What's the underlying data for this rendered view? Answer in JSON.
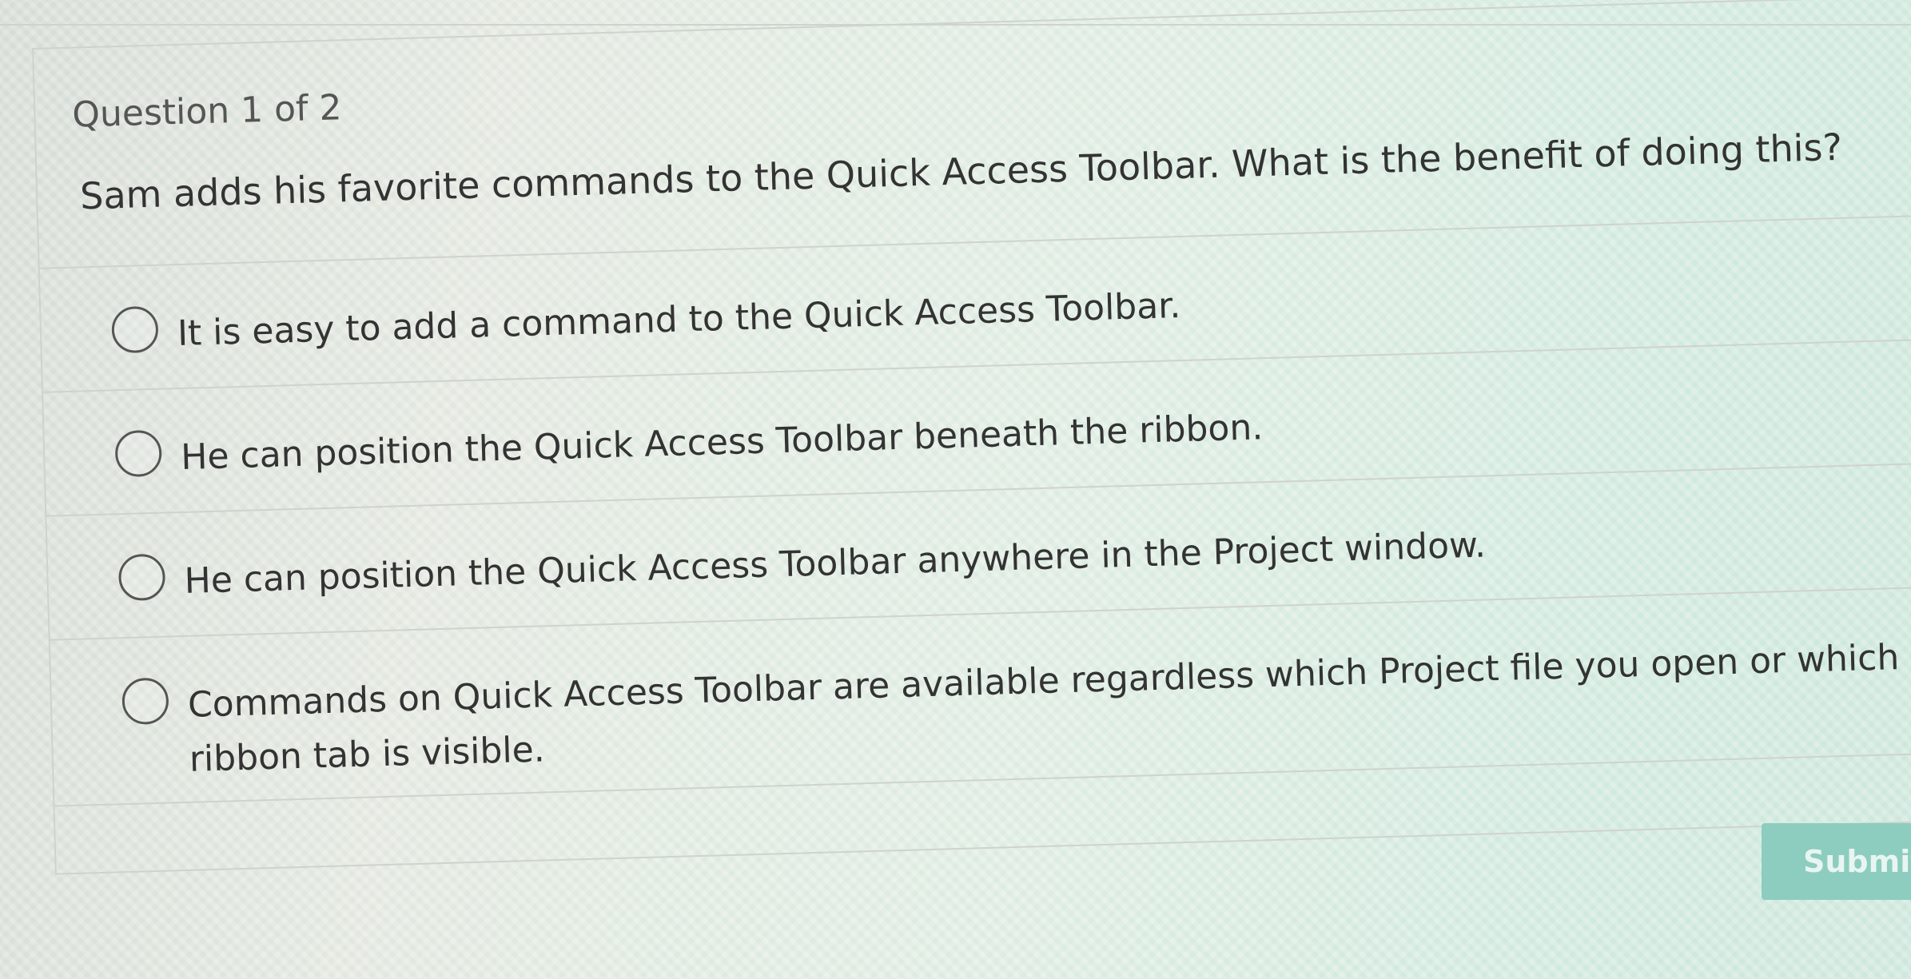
{
  "quiz": {
    "counter": "Question 1 of 2",
    "question": "Sam adds his favorite commands to the Quick Access Toolbar. What is the benefit of doing this?",
    "options": [
      {
        "label": "It is easy to add a command to the Quick Access Toolbar."
      },
      {
        "label": "He can position the Quick Access Toolbar beneath the ribbon."
      },
      {
        "label": "He can position the Quick Access Toolbar anywhere in the Project window."
      },
      {
        "label": "Commands on Quick Access Toolbar are available regardless which Project file you open or which ribbon tab is visible."
      }
    ],
    "submit_label": "Submit"
  }
}
